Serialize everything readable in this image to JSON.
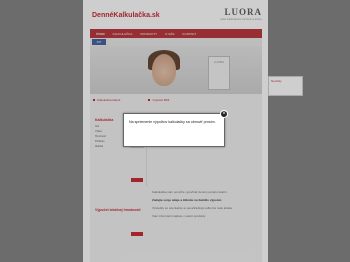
{
  "header": {
    "site_title": "DennéKalkulačka.sk",
    "logo_main": "LUORA",
    "logo_sub": "vaša kalkulačka zdravia a krásy"
  },
  "topnav": {
    "items": [
      {
        "label": "ÚVOD"
      },
      {
        "label": "KALKULAČKA"
      },
      {
        "label": "PRODUKTY"
      },
      {
        "label": "O NÁS"
      },
      {
        "label": "KONTAKT"
      }
    ]
  },
  "subnav": {
    "badge": "SIT"
  },
  "banner": {
    "product_label": "LUORA"
  },
  "content": {
    "tabs": [
      {
        "label": "Kalkulačka kalórií"
      },
      {
        "label": "Výpočet BMI"
      }
    ],
    "form1_title": "Kalkulačka",
    "form1_rows": [
      {
        "label": "Vek"
      },
      {
        "label": "Výška"
      },
      {
        "label": "Hmotnosť"
      },
      {
        "label": "Pohlavie"
      },
      {
        "label": "Aktivita"
      }
    ],
    "form2_title": "Výpočet ideálnej hmotnosti",
    "paragraphs": [
      {
        "text": "Kalkulačka vám pomôže vypočítať dennú potrebu kalórií.",
        "strong": false
      },
      {
        "text": "Zadajte svoje údaje a kliknite na tlačidlo výpočet.",
        "strong": true
      },
      {
        "text": "Výsledky sú orientačné a nenahrádzajú odbornú radu lekára.",
        "strong": false
      },
      {
        "text": "Viac informácií nájdete v sekcii produkty.",
        "strong": false
      }
    ]
  },
  "sidebar": {
    "text": "Novinky"
  },
  "modal": {
    "message": "Na spriemenie výpočtov kalkulačky sa obnoviť prosím.",
    "close_label": "×"
  }
}
